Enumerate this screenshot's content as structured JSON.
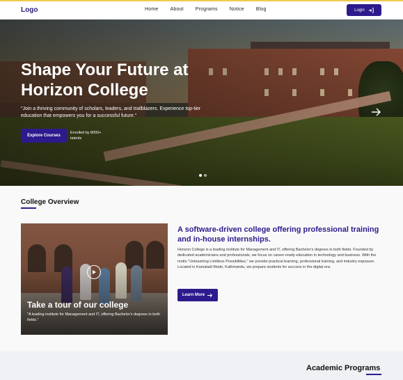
{
  "nav": {
    "logo": "Logo",
    "links": [
      "Home",
      "About",
      "Programs",
      "Notice",
      "Blog"
    ],
    "login_label": "Login"
  },
  "hero": {
    "title": "Shape Your Future at Horizon College",
    "subtitle": "\"Join a thriving community of scholars, leaders, and trailblazers. Experience top-tier education that empowers you for a successful future.\"",
    "cta_label": "Explore Courses",
    "enrolled_text": "Enrolled by 8000+ talents",
    "slide_count": 2,
    "active_slide": 1
  },
  "overview": {
    "section_title": "College Overview",
    "video_title": "Take a tour of our college",
    "video_caption": "\"A leading institute for Management and IT, offering Bachelor's degrees in both fields.\"",
    "heading": "A software-driven college offering professional training and in-house internships.",
    "body": "Horizon College is a leading institute for Management and IT, offering Bachelor's degrees in both fields. Founded by dedicated academicians and professionals, we focus on career-ready education in technology and business. With the motto \"Unleashing Limitless Possibilities,\" we provide practical learning, professional training, and industry exposure. Located in Kamaladi Mode, Kathmandu, we prepare students for success in the digital era.",
    "learn_more_label": "Learn More"
  },
  "programs": {
    "section_title": "Academic Programs"
  },
  "colors": {
    "accent": "#2d1a8c",
    "top_border": "#f2c94c"
  },
  "icons": {
    "login": "login-icon",
    "hero_next": "arrow-right-icon",
    "play": "play-icon",
    "learn_more": "arrow-right-icon"
  }
}
